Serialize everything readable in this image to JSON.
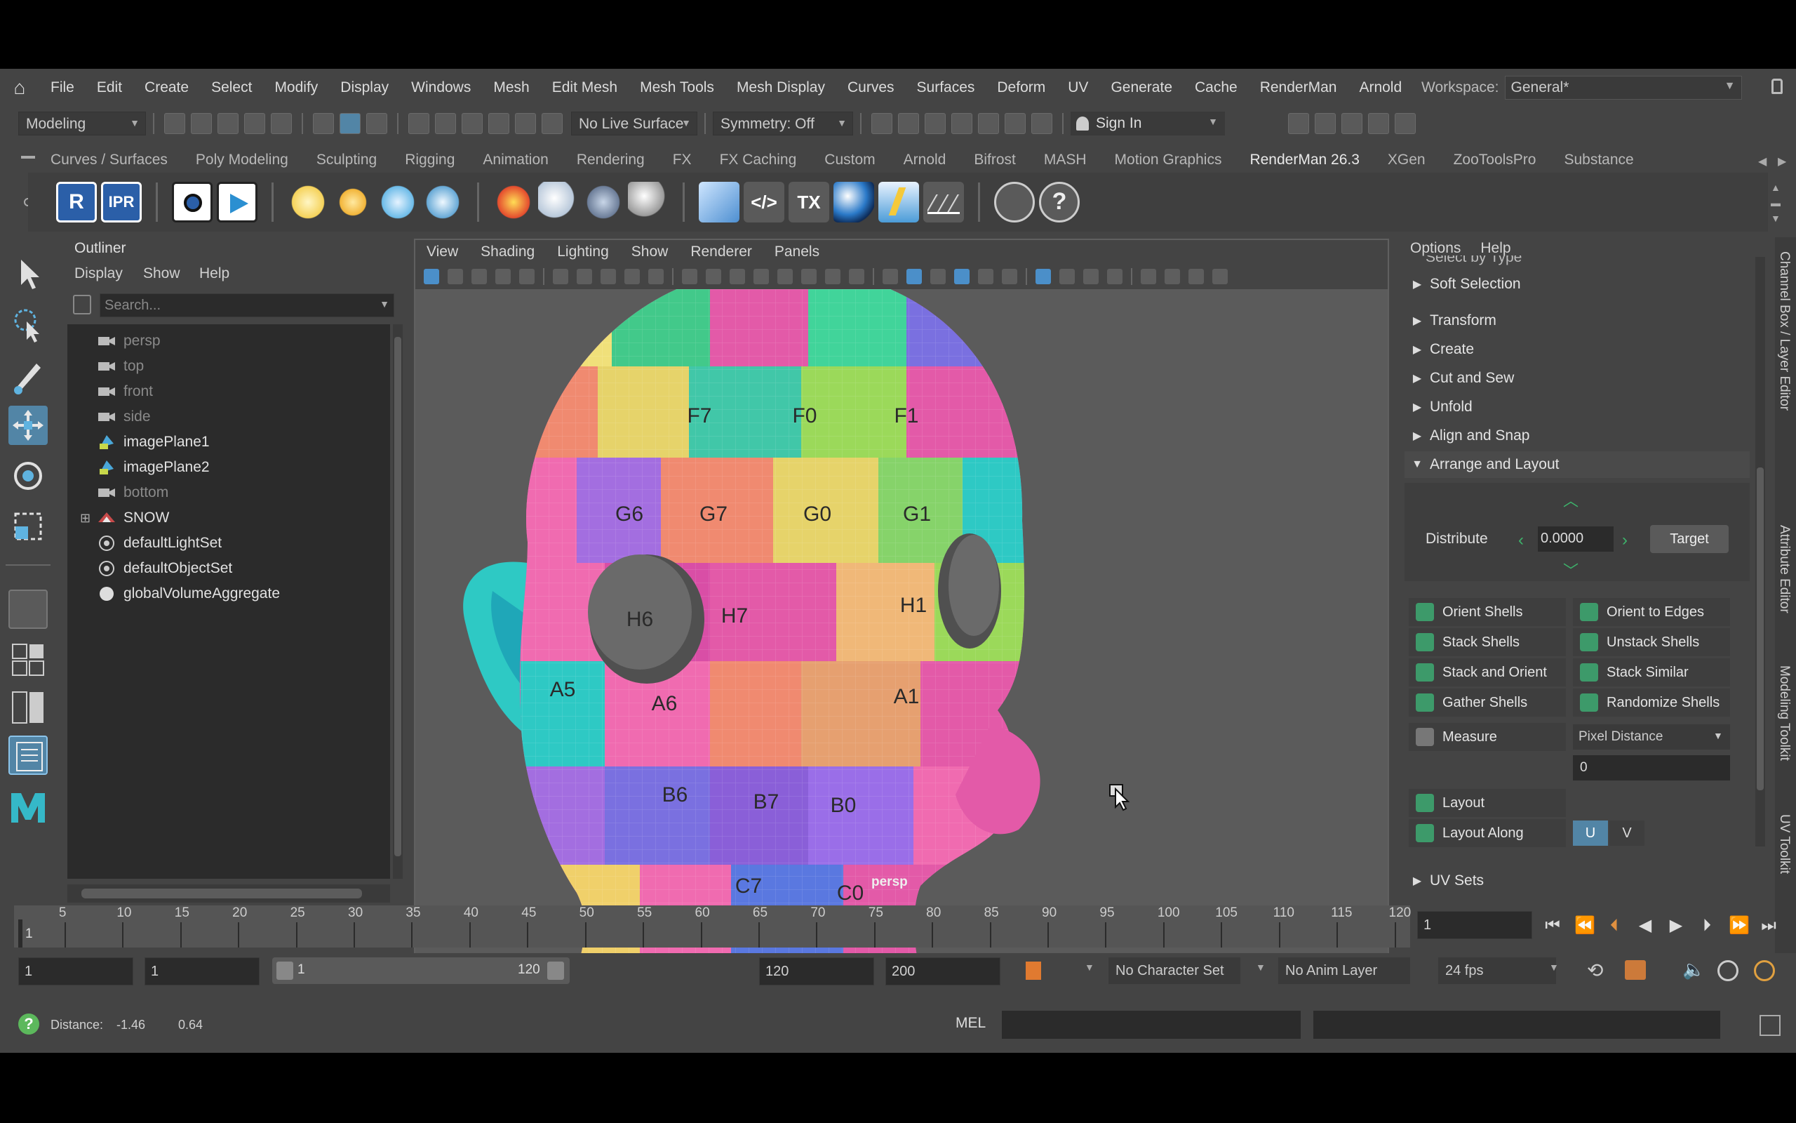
{
  "menubar": {
    "items": [
      "File",
      "Edit",
      "Create",
      "Select",
      "Modify",
      "Display",
      "Windows",
      "Mesh",
      "Edit Mesh",
      "Mesh Tools",
      "Mesh Display",
      "Curves",
      "Surfaces",
      "Deform",
      "UV",
      "Generate",
      "Cache",
      "RenderMan",
      "Arnold"
    ],
    "workspace_label": "Workspace:",
    "workspace_value": "General*"
  },
  "statusline": {
    "mode": "Modeling",
    "live_surface": "No Live Surface",
    "symmetry": "Symmetry: Off",
    "sign_in": "Sign In"
  },
  "shelf": {
    "tabs": [
      "Curves / Surfaces",
      "Poly Modeling",
      "Sculpting",
      "Rigging",
      "Animation",
      "Rendering",
      "FX",
      "FX Caching",
      "Custom",
      "Arnold",
      "Bifrost",
      "MASH",
      "Motion Graphics",
      "RenderMan 26.3",
      "XGen",
      "ZooToolsPro",
      "Substance"
    ],
    "active_tab": "RenderMan 26.3",
    "icon_labels": {
      "r": "R",
      "ipr": "IPR",
      "tx": "TX"
    }
  },
  "outliner": {
    "title": "Outliner",
    "menus": [
      "Display",
      "Show",
      "Help"
    ],
    "search_placeholder": "Search...",
    "items": [
      {
        "label": "persp",
        "icon": "camera-icon",
        "dim": true
      },
      {
        "label": "top",
        "icon": "camera-icon",
        "dim": true
      },
      {
        "label": "front",
        "icon": "camera-icon",
        "dim": true
      },
      {
        "label": "side",
        "icon": "camera-icon",
        "dim": true
      },
      {
        "label": "imagePlane1",
        "icon": "image-plane-icon",
        "dim": false
      },
      {
        "label": "imagePlane2",
        "icon": "image-plane-icon",
        "dim": false
      },
      {
        "label": "bottom",
        "icon": "camera-icon",
        "dim": true
      },
      {
        "label": "SNOW",
        "icon": "group-icon",
        "dim": false,
        "expandable": true
      },
      {
        "label": "defaultLightSet",
        "icon": "set-icon",
        "dim": false
      },
      {
        "label": "defaultObjectSet",
        "icon": "set-icon",
        "dim": false
      },
      {
        "label": "globalVolumeAggregate",
        "icon": "volume-icon",
        "dim": false
      }
    ]
  },
  "viewport": {
    "menus": [
      "View",
      "Shading",
      "Lighting",
      "Show",
      "Renderer",
      "Panels"
    ],
    "camera_label": "persp",
    "uv_labels": [
      "F7",
      "F0",
      "F1",
      "G6",
      "G7",
      "G0",
      "G1",
      "H6",
      "H7",
      "H1",
      "A5",
      "A6",
      "A1",
      "B6",
      "B7",
      "B0",
      "C7",
      "C0"
    ]
  },
  "uv_toolkit": {
    "menus": [
      "Options",
      "Help"
    ],
    "cut_header": "Select by Type",
    "sections": [
      "Soft Selection",
      "Transform",
      "Create",
      "Cut and Sew",
      "Unfold",
      "Align and Snap",
      "Arrange and Layout"
    ],
    "distribute_label": "Distribute",
    "distribute_value": "0.0000",
    "target_button": "Target",
    "buttons_left": [
      "Orient Shells",
      "Stack Shells",
      "Stack and Orient",
      "Gather Shells"
    ],
    "buttons_right": [
      "Orient to Edges",
      "Unstack Shells",
      "Stack Similar",
      "Randomize Shells"
    ],
    "measure_label": "Measure",
    "measure_mode": "Pixel Distance",
    "measure_value": "0",
    "layout_label": "Layout",
    "layout_along_label": "Layout Along",
    "u_label": "U",
    "v_label": "V",
    "uv_sets": "UV Sets"
  },
  "side_tabs": [
    "Channel Box / Layer Editor",
    "Attribute Editor",
    "Modeling Toolkit",
    "UV Toolkit"
  ],
  "timeline": {
    "ticks": [
      5,
      10,
      15,
      20,
      25,
      30,
      35,
      40,
      45,
      50,
      55,
      60,
      65,
      70,
      75,
      80,
      85,
      90,
      95,
      100,
      105,
      110,
      115,
      120
    ],
    "first_frame": "1",
    "current_frame": "1"
  },
  "range": {
    "start": "1",
    "anim_start": "1",
    "range_start": "1",
    "range_end": "120",
    "playback_end": "120",
    "anim_end": "200",
    "character_set": "No Character Set",
    "anim_layer": "No Anim Layer",
    "fps": "24 fps"
  },
  "commandline": {
    "help_label": "Distance:",
    "dist1": "-1.46",
    "dist2": "0.64",
    "lang": "MEL"
  },
  "colors": {
    "accent": "#5285a6",
    "bg": "#444444",
    "field": "#2b2b2b",
    "viewport": "#5b5b5b"
  }
}
